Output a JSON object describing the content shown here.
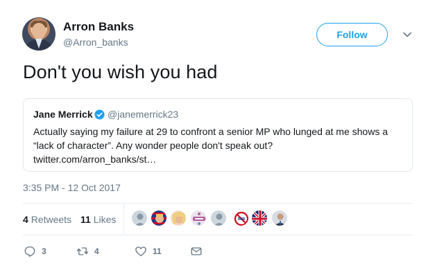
{
  "author": {
    "name": "Arron Banks",
    "handle": "@Arron_banks"
  },
  "follow_label": "Follow",
  "tweet_text": "Don't you wish you had",
  "quoted": {
    "name": "Jane Merrick",
    "handle": "@janemerrick23",
    "text_line1": "Actually saying my failure at 29 to confront a senior MP who lunged at me shows a",
    "text_line2": "“lack of character”. Any wonder people don't speak out?",
    "text_line3": "twitter.com/arron_banks/st…"
  },
  "timestamp": "3:35 PM - 12 Oct 2017",
  "stats": {
    "retweets_count": "4",
    "retweets_label": "Retweets",
    "likes_count": "11",
    "likes_label": "Likes"
  },
  "actions": {
    "replies": "3",
    "retweets": "4",
    "likes": "11"
  },
  "colors": {
    "accent": "#1da1f2",
    "secondary_text": "#657786",
    "border": "#e1e8ed"
  },
  "liker_avatars": [
    "default-avatar",
    "flag-face-avatar",
    "blonde-avatar",
    "britain-badge-avatar",
    "default-avatar",
    "no-sign-avatar",
    "union-jack-avatar",
    "suit-man-avatar"
  ]
}
